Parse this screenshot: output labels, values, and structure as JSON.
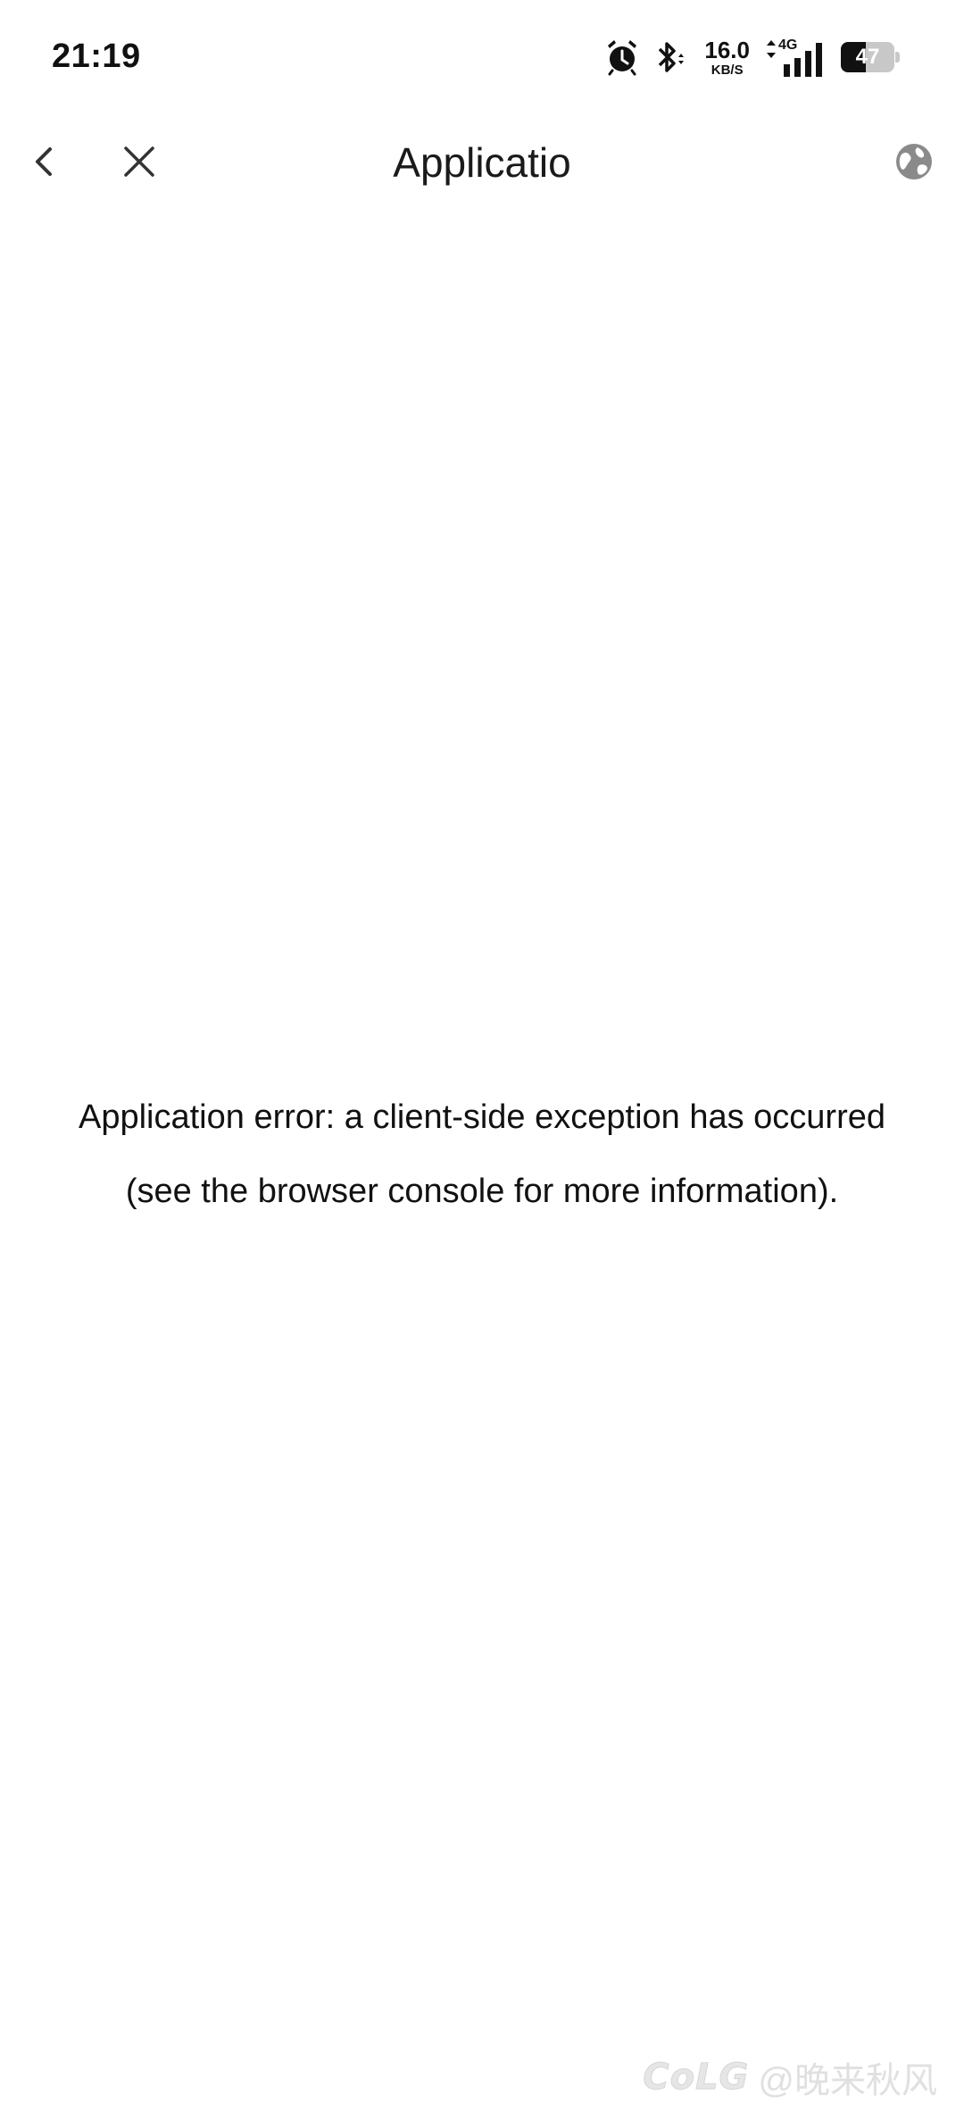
{
  "status_bar": {
    "time": "21:19",
    "net_speed_value": "16.0",
    "net_speed_unit": "KB/S",
    "network_type": "4G",
    "battery_level": "47",
    "battery_fraction": 0.47,
    "icons": [
      "alarm-icon",
      "bluetooth-icon",
      "data-arrows-icon",
      "signal-icon",
      "battery-icon"
    ]
  },
  "toolbar": {
    "title": "Applicatio",
    "back_icon": "chevron-left-icon",
    "close_icon": "close-icon",
    "globe_icon": "globe-icon"
  },
  "content": {
    "error_line_1": "Application error: a client-side exception has occurred",
    "error_line_2": "(see the browser console for more information)."
  },
  "watermark": {
    "logo": "CoLG",
    "user": "@晚来秋风"
  },
  "colors": {
    "background": "#ffffff",
    "text": "#111111",
    "icon_gray": "#8a8a8a",
    "watermark": "#e3e3e3"
  }
}
